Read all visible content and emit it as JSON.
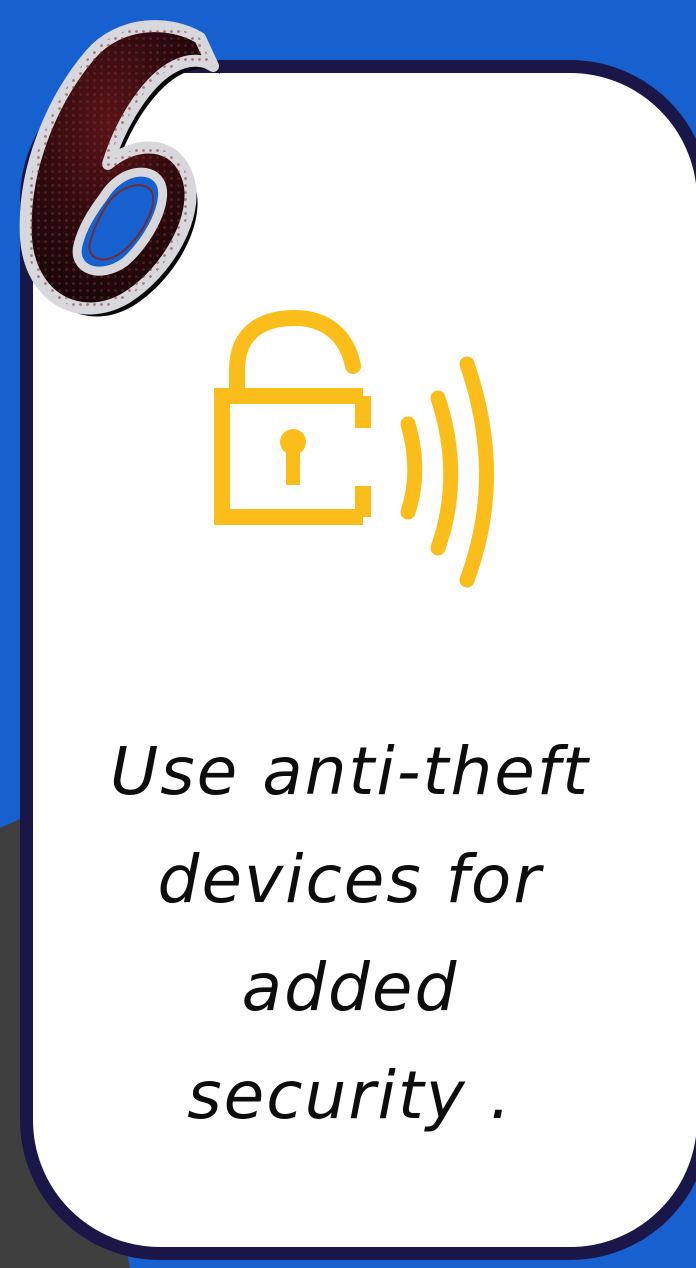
{
  "badge": {
    "number": "6"
  },
  "icon": {
    "name": "lock-signal-icon",
    "color": "#fbbd1a"
  },
  "caption": {
    "lines": [
      "Use anti-theft",
      "devices for",
      "added",
      "security ."
    ]
  },
  "colors": {
    "background": "#1660d0",
    "card_border": "#1b1648",
    "card_fill": "#ffffff",
    "accent": "#fbbd1a",
    "gray_shape": "#3f3f3f"
  }
}
